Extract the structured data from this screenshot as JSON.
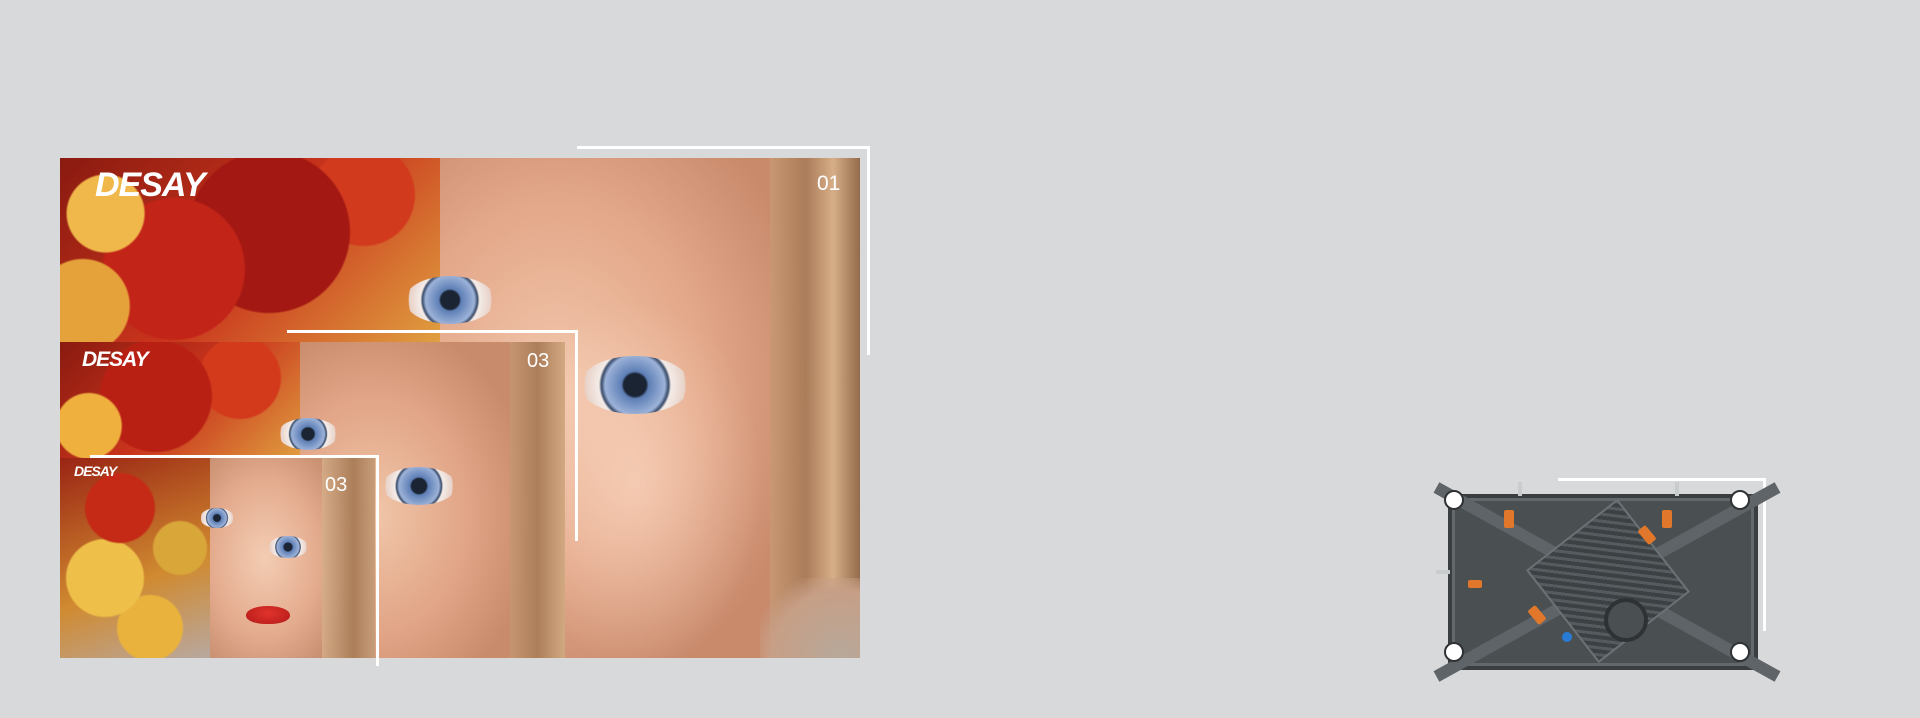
{
  "panels": {
    "large": {
      "brand": "DESAY",
      "number": "01"
    },
    "medium": {
      "brand": "DESAY",
      "number": "03"
    },
    "small": {
      "brand": "DESAY",
      "number": "03"
    }
  },
  "colors": {
    "background": "#d8d9db",
    "frame": "#ffffff",
    "cabinet": "#4a4f52",
    "accent_orange": "#e0772a",
    "accent_blue": "#2a7bd6"
  },
  "icons": [
    "led-cabinet-image",
    "flower-portrait-image"
  ]
}
